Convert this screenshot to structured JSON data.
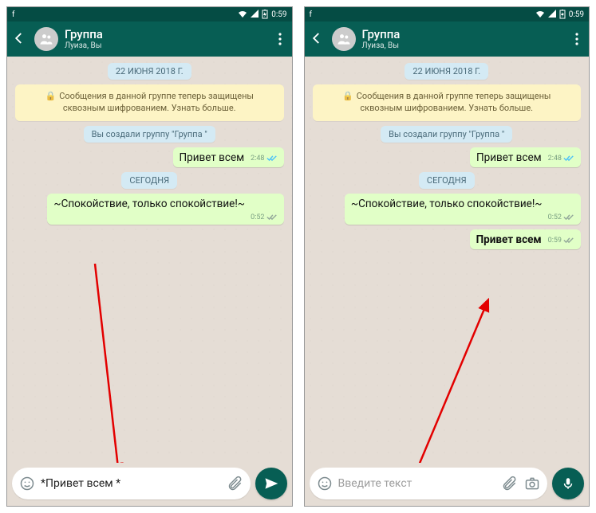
{
  "statusbar": {
    "left_icon": "f",
    "time": "0:59",
    "battery_icon": "battery",
    "wifi_icon": "wifi"
  },
  "header": {
    "group_title": "Группа",
    "group_subtitle": "Луиза, Вы"
  },
  "chat": {
    "date_label": "22 ИЮНЯ 2018 Г.",
    "encryption_text": "Сообщения в данной группе теперь защищены сквозным шифрованием. Узнать больше.",
    "created_text": "Вы создали группу \"Группа \"",
    "msg1_text": "Привет всем",
    "msg1_time": "2:48",
    "today_label": "СЕГОДНЯ",
    "msg2_text": "~Спокойствие, только спокойствие!~",
    "msg2_time": "0:52",
    "msg3_text": "Привет всем",
    "msg3_time": "0:59"
  },
  "input_left": {
    "value": "*Привет всем *"
  },
  "input_right": {
    "placeholder": "Введите текст"
  }
}
